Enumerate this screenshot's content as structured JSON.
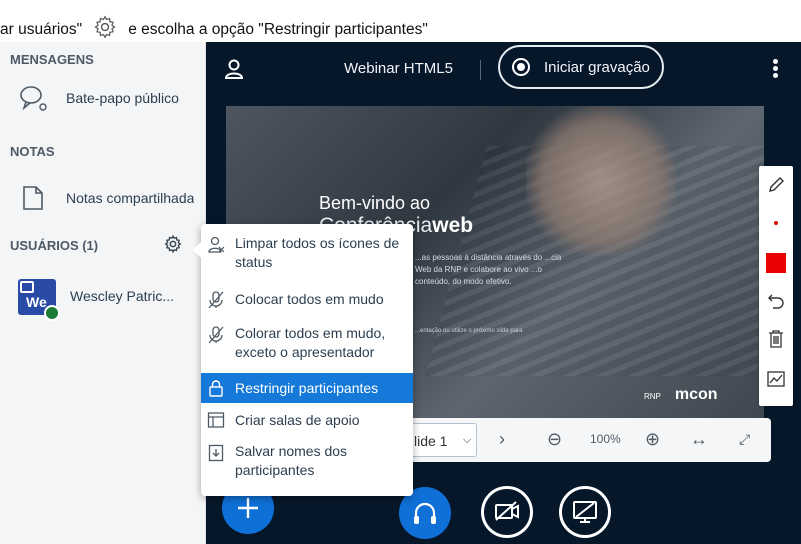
{
  "caption": {
    "text_before": "ar usuários\"",
    "text_after": "e escolha a opção \"Restringir participantes\""
  },
  "sidebar": {
    "messages_title": "MENSAGENS",
    "public_chat_label": "Bate-papo público",
    "notes_title": "NOTAS",
    "shared_notes_label": "Notas compartilhadas",
    "users_title": "USUÁRIOS (1)",
    "users": [
      {
        "initials": "We",
        "name": "Wescley Patric..."
      }
    ]
  },
  "topbar": {
    "meeting_title": "Webinar HTML5",
    "record_label": "Iniciar gravação"
  },
  "slide": {
    "welcome": "Bem-vindo ao",
    "brand_light": "Conferência",
    "brand_bold": "web",
    "description": "...as pessoas à distância através do ...cia Web da RNP e colabore ao vivo ...o conteúdo, do modo efetivo.",
    "note": "...entação ou utilize o próximo slide para",
    "logo_rnp": "RNP",
    "logo_mconf": "mcon"
  },
  "presentation_toolbar": {
    "slide_select_value": "lide 1",
    "zoom": "100%"
  },
  "users_menu": {
    "items": [
      {
        "label": "Limpar todos os ícones de status",
        "icon": "user-clear-icon",
        "active": false
      },
      {
        "label": "Colocar todos em mudo",
        "icon": "mic-mute-icon",
        "active": false
      },
      {
        "label": "Colorar todos em mudo, exceto o apresentador",
        "icon": "mic-mute-icon",
        "active": false
      },
      {
        "label": "Restringir participantes",
        "icon": "lock-icon",
        "active": true
      },
      {
        "label": "Criar salas de apoio",
        "icon": "rooms-icon",
        "active": false
      },
      {
        "label": "Salvar nomes dos participantes",
        "icon": "download-icon",
        "active": false
      }
    ]
  },
  "colors": {
    "main_bg": "#06172a",
    "sidebar_bg": "#f3f5f7",
    "accent_blue": "#0f70d7",
    "active_item": "#1479d8",
    "whiteboard_red": "#e90000"
  }
}
